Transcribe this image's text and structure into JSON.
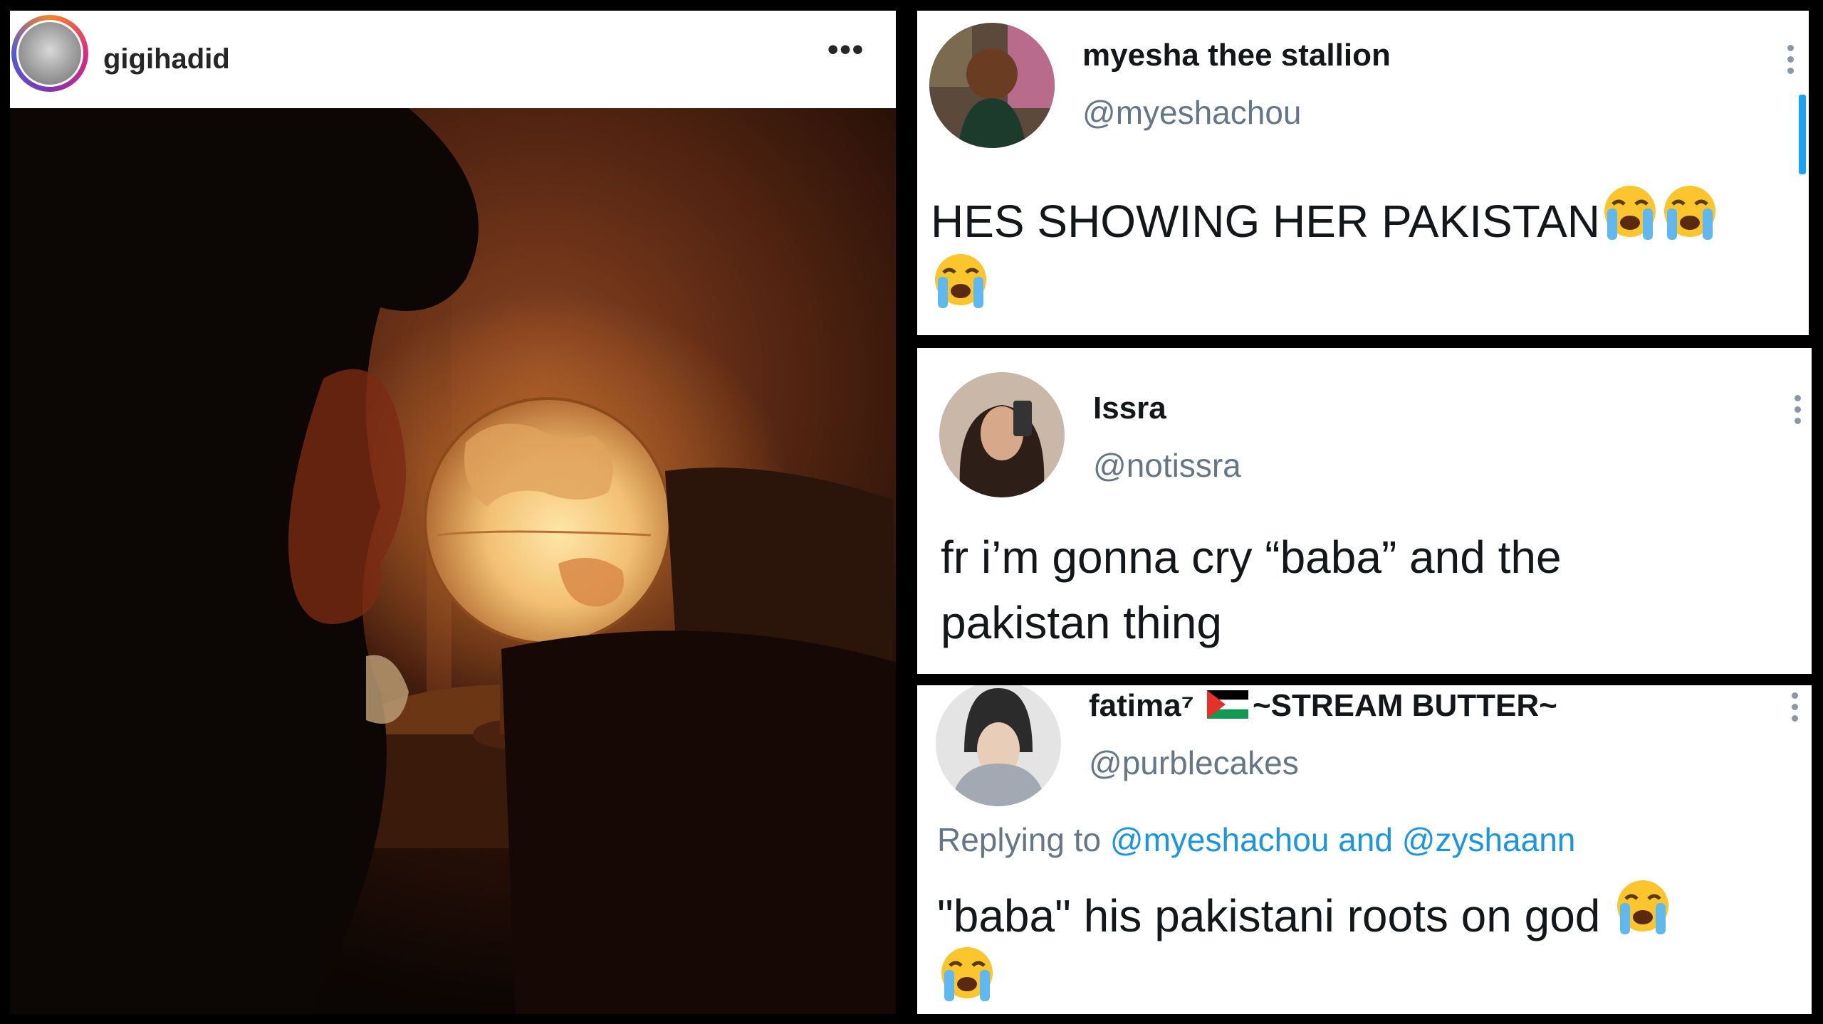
{
  "instagram": {
    "username": "gigihadid",
    "more_label": "•••"
  },
  "tweets": [
    {
      "name": "myesha thee stallion",
      "handle": "@myeshachou",
      "text": "HES SHOWING HER PAKISTAN"
    },
    {
      "name": "Issra",
      "handle": "@notissra",
      "text_line1": "fr i’m gonna cry “baba” and the",
      "text_line2": "pakistan thing"
    },
    {
      "name_prefix": "fatima⁷",
      "name_suffix": "~STREAM BUTTER~",
      "handle": "@purblecakes",
      "reply_prefix": "Replying to",
      "reply_mention1": "@myeshachou",
      "reply_and": "and",
      "reply_mention2": "@zyshaann",
      "text": "\"baba\" his pakistani roots on god"
    }
  ],
  "icons": {
    "emoji": "loudly-crying-face-emoji",
    "flag": "palestine-flag-icon",
    "more": "kebab-menu-icon"
  },
  "colors": {
    "name": "#14171a",
    "handle": "#657786",
    "mention": "#1b95e0",
    "emoji_face": "#fbc52d",
    "emoji_tears": "#5fb8ef"
  }
}
